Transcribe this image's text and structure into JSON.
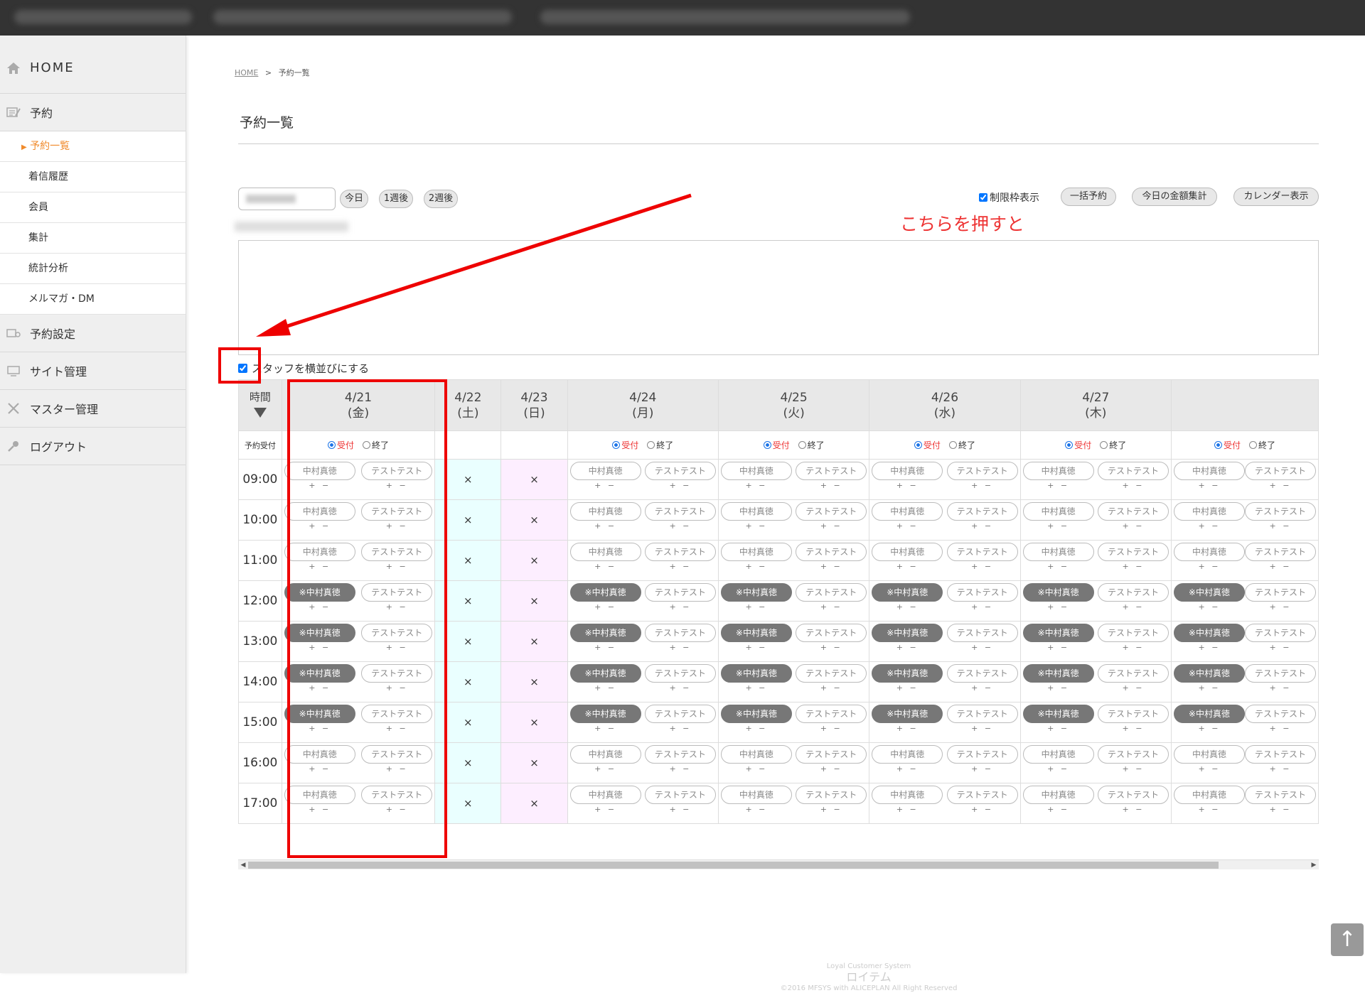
{
  "sidebar": {
    "home": "HOME",
    "reserve": "予約",
    "sub": [
      "予約一覧",
      "着信履歴",
      "会員",
      "集計",
      "統計分析",
      "メルマガ・DM"
    ],
    "reserve_settings": "予約設定",
    "site_admin": "サイト管理",
    "master_admin": "マスター管理",
    "logout": "ログアウト"
  },
  "breadcrumb": {
    "home": "HOME",
    "sep": ">",
    "current": "予約一覧"
  },
  "page_title": "予約一覧",
  "toolbar": {
    "today": "今日",
    "week1": "1週後",
    "week2": "2週後",
    "limit_label": "制限枠表示",
    "bulk": "一括予約",
    "daily_total": "今日の金額集計",
    "calendar": "カレンダー表示"
  },
  "staff_check_label": "スタッフを横並びにする",
  "annotation": "こちらを押すと",
  "grid": {
    "time_header": "時間",
    "receive_label": "予約受付",
    "radio_on": "受付",
    "radio_off": "終了",
    "closed_mark": "×",
    "plus_minus": "+ −",
    "staff1": "中村真徳",
    "staff1_booked": "※中村真徳",
    "staff2": "テストテスト",
    "days": [
      {
        "date": "4/21",
        "dow": "(金)",
        "type": "open"
      },
      {
        "date": "4/22",
        "dow": "(土)",
        "type": "sat"
      },
      {
        "date": "4/23",
        "dow": "(日)",
        "type": "sun"
      },
      {
        "date": "4/24",
        "dow": "(月)",
        "type": "open"
      },
      {
        "date": "4/25",
        "dow": "(火)",
        "type": "open"
      },
      {
        "date": "4/26",
        "dow": "(水)",
        "type": "open"
      },
      {
        "date": "4/27",
        "dow": "(木)",
        "type": "open"
      },
      {
        "date": "",
        "dow": "",
        "type": "open"
      }
    ],
    "times": [
      "09:00",
      "10:00",
      "11:00",
      "12:00",
      "13:00",
      "14:00",
      "15:00",
      "16:00",
      "17:00"
    ],
    "booked_times": [
      "12:00",
      "13:00",
      "14:00",
      "15:00"
    ]
  },
  "footer": {
    "line1": "Loyal Customer System",
    "line2": "ロイテム",
    "line3": "©2016 MFSYS with ALICEPLAN All Right Reserved"
  },
  "to_top": "↑"
}
